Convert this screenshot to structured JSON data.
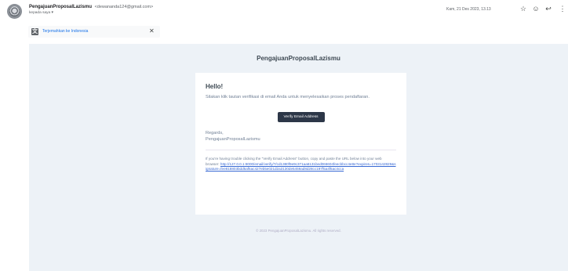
{
  "header": {
    "sender_name": "PengajuanProposalLazismu",
    "sender_email": "<dewananda124@gmail.com>",
    "recipient": "kepada saya ▾",
    "date": "Kam, 21 Des 2023, 13.13"
  },
  "translate": {
    "link_text": "Terjemahkan ke Indonesia",
    "close_glyph": "✕"
  },
  "email": {
    "brand_title": "PengajuanProposalLazismu",
    "greeting": "Hello!",
    "intro": "Silakan klik tautan verifikasi di email Anda untuk menyelesaikan proses pendaftaran.",
    "button_label": "Verify Email Address",
    "regards_line1": "Regards,",
    "regards_line2": "PengajuanProposalLazismu",
    "subcopy_text": "If you're having trouble clicking the \"Verify Email Address\" button, copy and paste the URL below into your web browser: ",
    "subcopy_url": "http://127.0.0.1:8000/email/verify/7/cd1380f9e9c371aa6131bed066604feecbbcc4e8e?expires=1703142829&signature=fee818803bdd5af5ac427eb5e021d2a3130de5459ad8d28cc197f5a4f5ac4cca",
    "footer": "© 2023 PengajuanProposalLazismu. All rights reserved."
  },
  "icons": {
    "star": "☆",
    "emoji": "☺",
    "reply": "↩",
    "more": "⋮",
    "translate": "文"
  },
  "colors": {
    "email_background": "#edf2f7",
    "button": "#2d3748",
    "link": "#3869d4",
    "gmail_link": "#1a73e8"
  }
}
